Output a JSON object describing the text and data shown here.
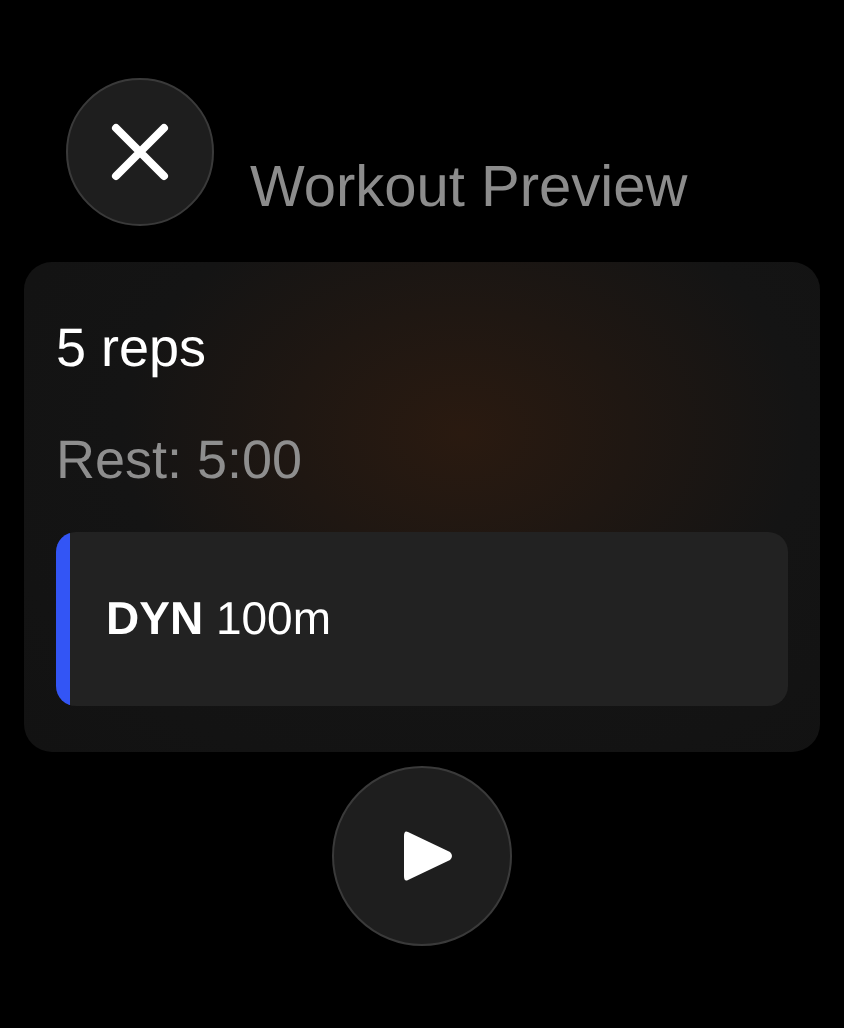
{
  "header": {
    "title": "Workout Preview"
  },
  "workout": {
    "reps": "5 reps",
    "rest": "Rest: 5:00",
    "intervals": [
      {
        "stroke": "DYN",
        "distance": "100m",
        "color": "#3355f5"
      }
    ]
  }
}
